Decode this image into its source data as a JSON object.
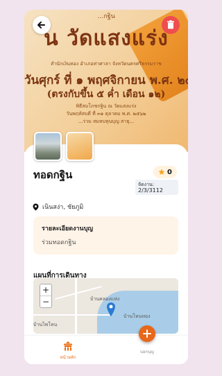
{
  "hero": {
    "line1": "…กฐิน",
    "line2": "น วัดแสงแร่ง",
    "line3": "สำนักเงินทอง อำเภอท่าศาลา จังหวัดนครศรีธรรมราช",
    "line4": "วันศุกร์ ที่ ๑ พฤศจิกายน พ.ศ. ๒๕",
    "line5": "(ตรงกับขึ้น ๕ ค่ำ เดือน ๑๒)",
    "line6": "พิธีสมโภชกฐิน ณ วัดแสงแร่ง",
    "line7": "วันพฤหัสบดี ที่ ๓๑ ตุลาคม พ.ศ. ๒๕๖๒",
    "line8": "...ร่วม สมทบทุนบุญ สาธุ..."
  },
  "event": {
    "title": "ทอดกฐิน",
    "stars": "0",
    "date_label": "จัดงาน:",
    "date_value": "2/3/3112",
    "location": "เนินสง่า, ชัยภูมิ"
  },
  "details": {
    "heading": "รายละเอียดงานบุญ",
    "value": "ร่วมทอดกฐิน"
  },
  "map": {
    "title": "แผนที่การเดินทาง",
    "zoom_in": "+",
    "zoom_out": "−",
    "label_area": "บ้านคลองแห่ง",
    "label_water": "บ้านโหนทอง",
    "label_left": "บ้านไพโหน"
  },
  "nav": {
    "home_label": "หน้าหลัก",
    "add_label": "บอกบุญ"
  },
  "colors": {
    "accent": "#e8671a",
    "delete": "#ee4e4e",
    "star": "#f5a623"
  }
}
